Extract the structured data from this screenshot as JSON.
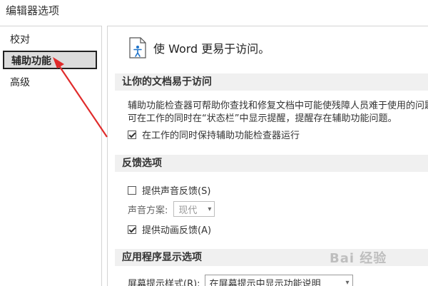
{
  "window": {
    "title": "编辑器选项"
  },
  "sidebar": {
    "items": [
      {
        "label": "校对",
        "selected": false
      },
      {
        "label": "辅助功能",
        "selected": true
      },
      {
        "label": "高级",
        "selected": false
      }
    ]
  },
  "main": {
    "header": "使 Word 更易于访问。",
    "sections": [
      {
        "title": "让你的文档易于访问",
        "description_lines": [
          "辅助功能检查器可帮助你查找和修复文档中可能使残障人员难于使用的问题",
          "可在工作的同时在“状态栏”中显示提醒，提醒存在辅助功能问题。"
        ],
        "checkbox": {
          "label": "在工作的同时保持辅助功能检查器运行",
          "checked": true
        }
      },
      {
        "title": "反馈选项",
        "checkbox_sound": {
          "label": "提供声音反馈(S)",
          "checked": false
        },
        "sound_scheme": {
          "label": "声音方案:",
          "value": "现代"
        },
        "checkbox_animation": {
          "label": "提供动画反馈(A)",
          "checked": true
        }
      },
      {
        "title": "应用程序显示选项",
        "screen_tip": {
          "label": "屏幕提示样式(R):",
          "value": "在屏幕提示中显示功能说明"
        }
      }
    ]
  },
  "watermark": "Bai 经验",
  "colors": {
    "annotation_arrow": "#e02b2b",
    "section_bg": "#f0f0f0",
    "selected_bg": "#dcdcdc"
  }
}
